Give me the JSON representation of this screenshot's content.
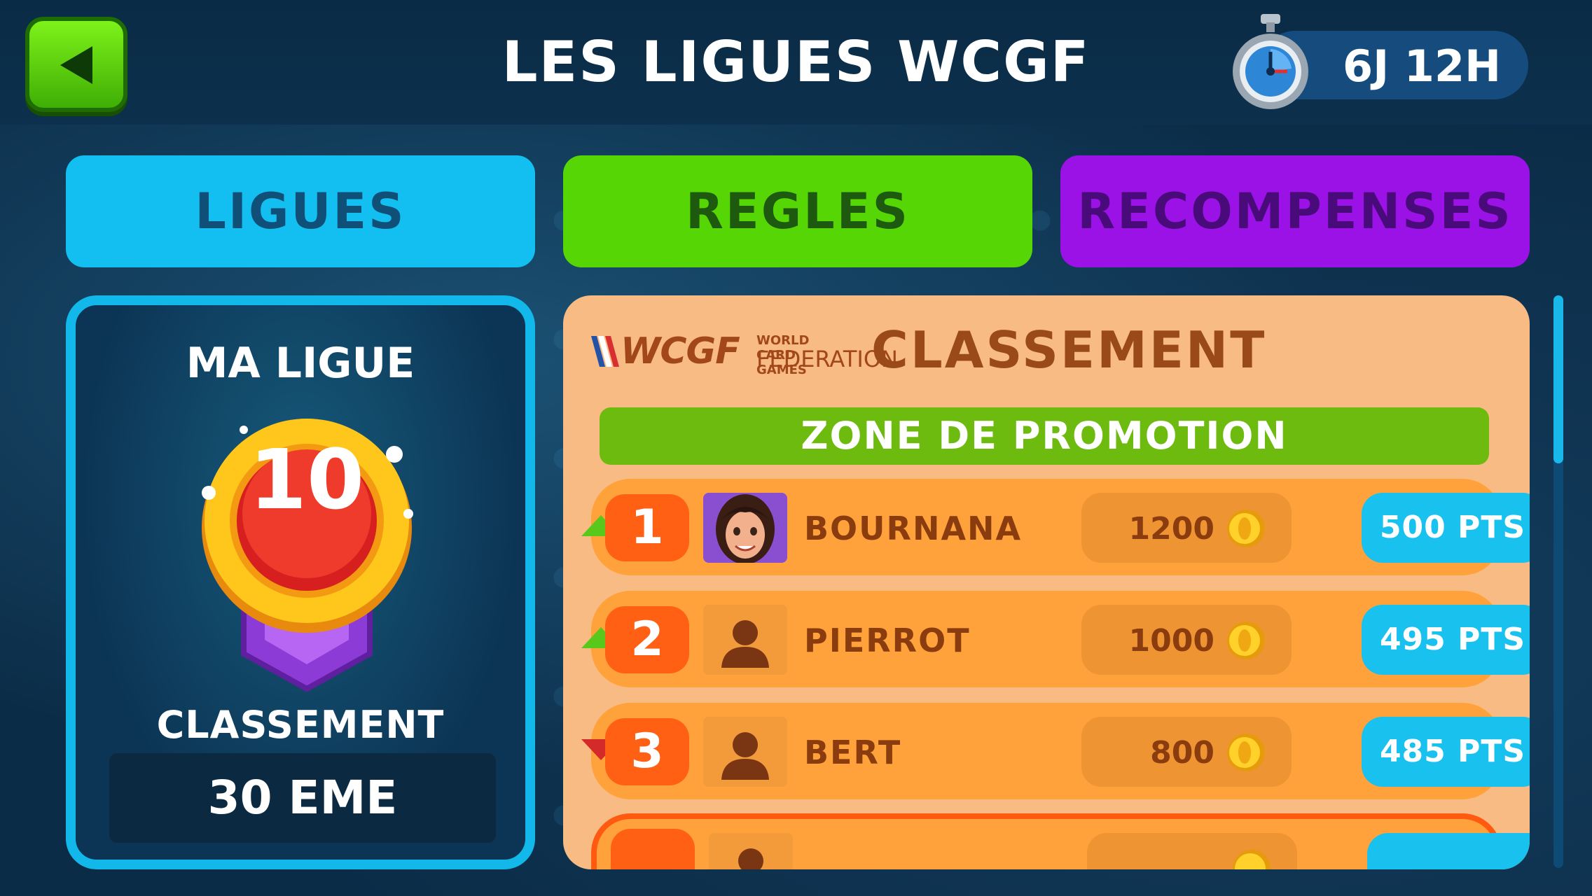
{
  "header": {
    "title": "LES LIGUES WCGF",
    "timer": "6J 12H",
    "back_icon": "back-arrow-icon"
  },
  "tabs": [
    {
      "label": "LIGUES",
      "color": "#12bff0"
    },
    {
      "label": "REGLES",
      "color": "#57d606"
    },
    {
      "label": "RECOMPENSES",
      "color": "#9b12e6"
    }
  ],
  "my_league": {
    "title": "MA LIGUE",
    "medal_number": "10",
    "rank_label": "CLASSEMENT",
    "rank_value": "30 EME"
  },
  "board": {
    "logo": {
      "letters": "WCGF",
      "line1": "WORLD CARD GAMES",
      "line2": "FEDERATION"
    },
    "title": "CLASSEMENT",
    "promotion_label": "ZONE DE PROMOTION",
    "rows": [
      {
        "rank": "1",
        "name": "BOURNANA",
        "coins": "1200",
        "points": "500 PTS",
        "trend": "up",
        "avatar": "woman-avatar"
      },
      {
        "rank": "2",
        "name": "PIERROT",
        "coins": "1000",
        "points": "495 PTS",
        "trend": "up",
        "avatar": "default-avatar"
      },
      {
        "rank": "3",
        "name": "BERT",
        "coins": "800",
        "points": "485 PTS",
        "trend": "down",
        "avatar": "default-avatar"
      }
    ]
  },
  "colors": {
    "up": "#58c81a",
    "down": "#d42a2a",
    "rank_badge": "#ff6013",
    "points_badge": "#19c1ef"
  }
}
